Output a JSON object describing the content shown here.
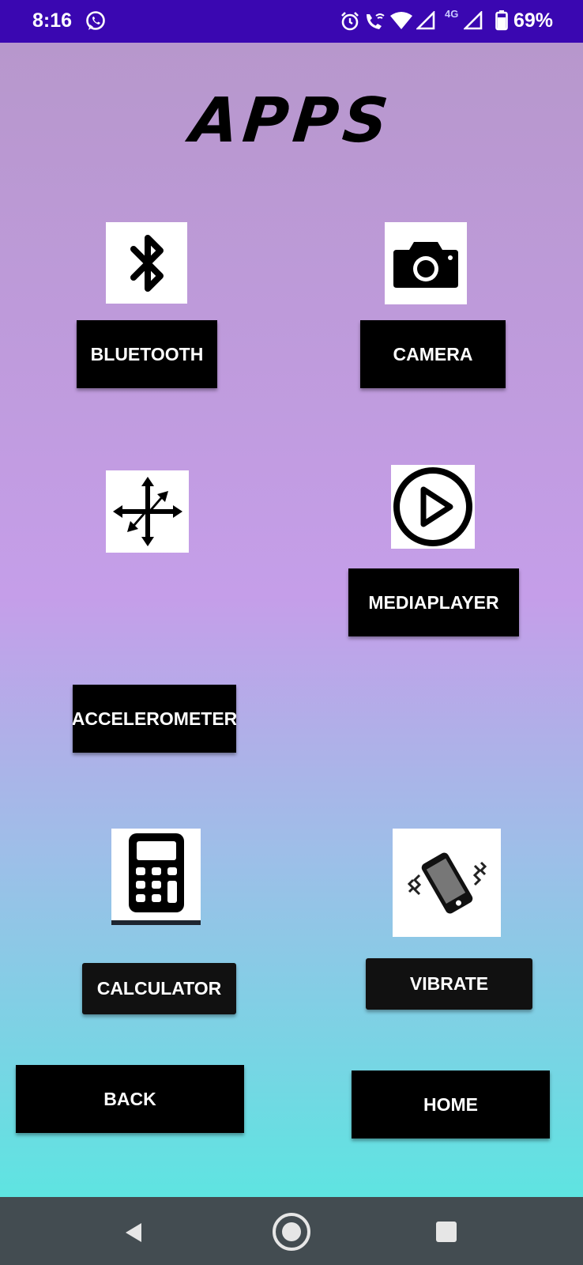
{
  "status_bar": {
    "time": "8:16",
    "network": "4G",
    "battery": "69%"
  },
  "title": "APPS",
  "apps": {
    "bluetooth_label": "BLUETOOTH",
    "camera_label": "CAMERA",
    "mediaplayer_label": "MEDIAPLAYER",
    "accelerometer_label": "ACCELEROMETER",
    "calculator_label": "CALCULATOR",
    "vibrate_label": "VIBRATE"
  },
  "nav": {
    "back_label": "BACK",
    "home_label": "HOME"
  },
  "icons": {
    "bluetooth": "bluetooth-icon",
    "camera": "camera-icon",
    "accelerometer": "move-arrows-icon",
    "mediaplayer": "play-circle-icon",
    "calculator": "calculator-icon",
    "vibrate": "vibrating-phone-icon"
  },
  "colors": {
    "status_bar": "#3a07b1",
    "button": "#000000",
    "nav_bar": "#434c51"
  }
}
